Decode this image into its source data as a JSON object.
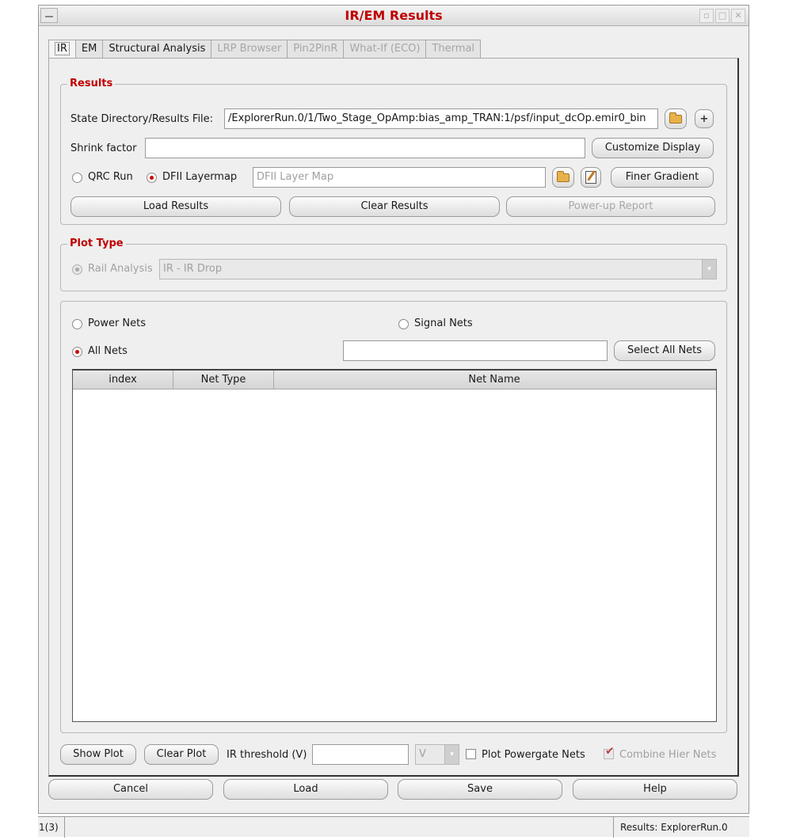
{
  "window": {
    "title": "IR/EM Results"
  },
  "tabs": [
    {
      "label": "IR",
      "state": "active"
    },
    {
      "label": "EM",
      "state": "normal"
    },
    {
      "label": "Structural Analysis",
      "state": "normal"
    },
    {
      "label": "LRP Browser",
      "state": "disabled"
    },
    {
      "label": "Pin2PinR",
      "state": "disabled"
    },
    {
      "label": "What-If (ECO)",
      "state": "disabled"
    },
    {
      "label": "Thermal",
      "state": "disabled"
    }
  ],
  "results": {
    "legend": "Results",
    "state_dir_label": "State Directory/Results File:",
    "state_dir_value": "/ExplorerRun.0/1/Two_Stage_OpAmp:bias_amp_TRAN:1/psf/input_dcOp.emir0_bin",
    "shrink_label": "Shrink factor",
    "shrink_value": "",
    "customize_display": "Customize Display",
    "qrc_run": "QRC Run",
    "dfii_layermap": "DFII Layermap",
    "layermap_placeholder": "DFII Layer Map",
    "finer_gradient": "Finer Gradient",
    "load_results": "Load Results",
    "clear_results": "Clear Results",
    "powerup_report": "Power-up Report"
  },
  "plot_type": {
    "legend": "Plot Type",
    "rail_analysis": "Rail Analysis",
    "selected": "IR - IR Drop"
  },
  "nets": {
    "power_nets": "Power Nets",
    "signal_nets": "Signal Nets",
    "all_nets": "All Nets",
    "filter_value": "",
    "select_all": "Select All Nets",
    "columns": [
      "index",
      "Net Type",
      "Net Name"
    ],
    "rows": []
  },
  "plot_controls": {
    "show_plot": "Show Plot",
    "clear_plot": "Clear Plot",
    "ir_threshold_label": "IR threshold (V)",
    "ir_threshold_value": "",
    "unit": "V",
    "plot_powergate": "Plot Powergate Nets",
    "combine_hier": "Combine Hier Nets"
  },
  "footer": {
    "cancel": "Cancel",
    "load": "Load",
    "save": "Save",
    "help": "Help"
  },
  "status": {
    "left": "1(3)",
    "right": "Results: ExplorerRun.0"
  }
}
